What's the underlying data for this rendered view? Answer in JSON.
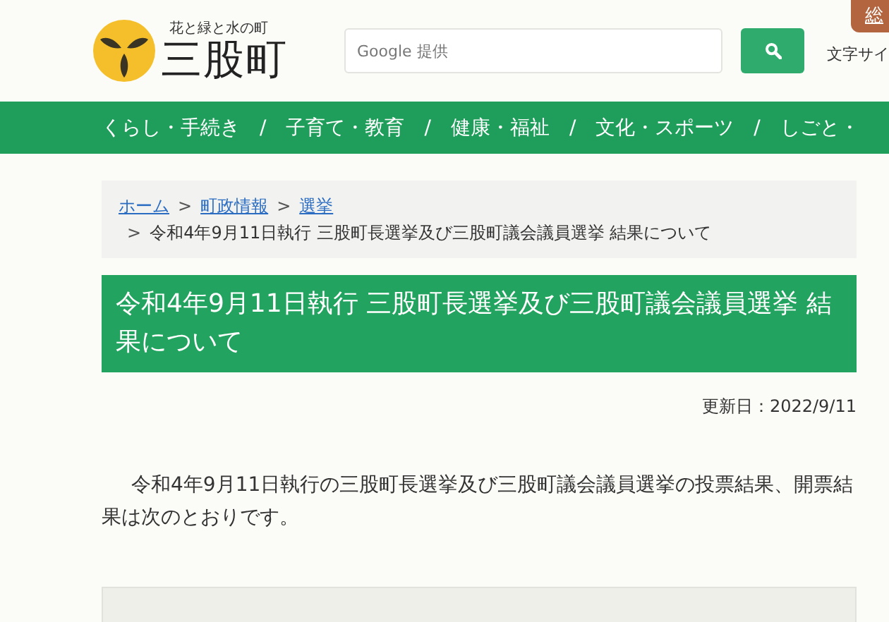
{
  "header": {
    "tagline": "花と緑と水の町",
    "town_name": "三股町",
    "search": {
      "placeholder": "Google 提供"
    },
    "text_size_label": "文字サイ",
    "corner_tab": "総"
  },
  "nav": [
    {
      "label": "くらし・手続き"
    },
    {
      "label": "子育て・教育"
    },
    {
      "label": "健康・福祉"
    },
    {
      "label": "文化・スポーツ"
    },
    {
      "label": "しごと・"
    }
  ],
  "nav_separator": "/",
  "breadcrumb": {
    "links": [
      {
        "label": "ホーム"
      },
      {
        "label": "町政情報"
      },
      {
        "label": "選挙"
      }
    ],
    "separator": ">",
    "current": "令和4年9月11日執行 三股町長選挙及び三股町議会議員選挙 結果について"
  },
  "page_title": "令和4年9月11日執行 三股町長選挙及び三股町議会議員選挙 結果について",
  "updated": "更新日：2022/9/11",
  "body": "令和4年9月11日執行の三股町長選挙及び三股町議会議員選挙の投票結果、開票結果は次のとおりです。"
}
